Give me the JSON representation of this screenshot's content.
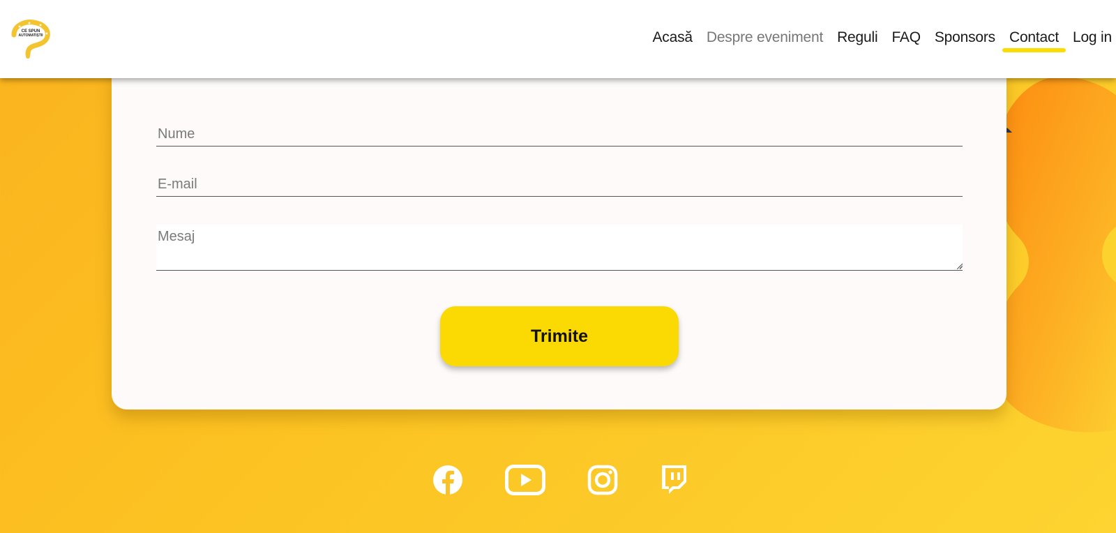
{
  "header": {
    "logo_text_top": "CE SPUN",
    "logo_text_bottom": "AUTOMATIȘTII",
    "nav": [
      {
        "label": "Acasă",
        "state": "normal"
      },
      {
        "label": "Despre eveniment",
        "state": "muted"
      },
      {
        "label": "Reguli",
        "state": "normal"
      },
      {
        "label": "FAQ",
        "state": "normal"
      },
      {
        "label": "Sponsors",
        "state": "normal"
      },
      {
        "label": "Contact",
        "state": "active"
      },
      {
        "label": "Log in",
        "state": "normal"
      }
    ]
  },
  "form": {
    "name_placeholder": "Nume",
    "email_placeholder": "E-mail",
    "message_placeholder": "Mesaj",
    "submit_label": "Trimite"
  },
  "social": [
    {
      "name": "facebook-icon"
    },
    {
      "name": "youtube-icon"
    },
    {
      "name": "instagram-icon"
    },
    {
      "name": "twitch-icon"
    }
  ],
  "colors": {
    "accent": "#fbd903",
    "nav_underline": "#fddc04",
    "background_start": "#fbb31e",
    "background_end": "#fdd431",
    "card": "#fdfaf9"
  }
}
